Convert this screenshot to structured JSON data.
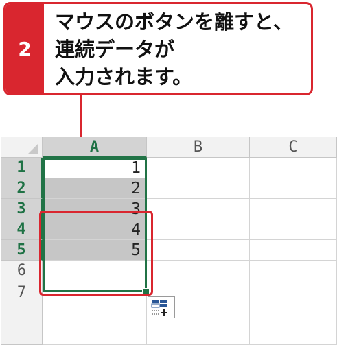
{
  "callout": {
    "step": "2",
    "lines": [
      "マウスのボタンを離すと、",
      "連続データが",
      "入力されます。"
    ]
  },
  "sheet": {
    "columns": [
      "A",
      "B",
      "C"
    ],
    "rows": [
      "1",
      "2",
      "3",
      "4",
      "5",
      "6",
      "7"
    ],
    "column_a_values": [
      "1",
      "2",
      "3",
      "4",
      "5",
      "",
      ""
    ]
  },
  "colors": {
    "accent_red": "#d9262f",
    "excel_green": "#217346"
  },
  "icons": {
    "autofill": "auto-fill-options-icon"
  }
}
